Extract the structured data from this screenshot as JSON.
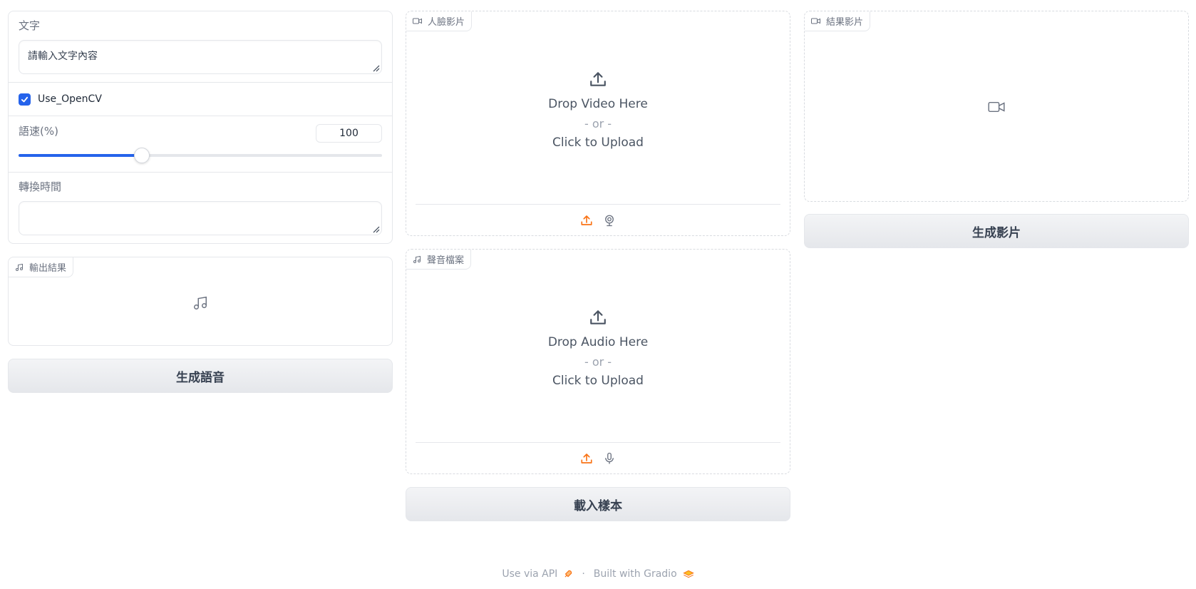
{
  "left": {
    "text_label": "文字",
    "text_placeholder": "請輸入文字內容",
    "checkbox_label": "Use_OpenCV",
    "checkbox_checked": true,
    "speed_label": "語速(%)",
    "speed_value": "100",
    "speed_fraction": 0.34,
    "time_label": "轉換時間",
    "time_value": "",
    "output_label": "輸出結果",
    "generate_button": "生成語音"
  },
  "middle": {
    "video_label": "人臉影片",
    "video_drop": "Drop Video Here",
    "or_text": "- or -",
    "click_upload": "Click to Upload",
    "audio_label": "聲音檔案",
    "audio_drop": "Drop Audio Here",
    "or_text2": "- or -",
    "click_upload2": "Click to Upload",
    "load_button": "載入樣本"
  },
  "right": {
    "result_label": "結果影片",
    "generate_button": "生成影片"
  },
  "footer": {
    "api": "Use via API",
    "dot": "·",
    "built": "Built with Gradio"
  },
  "colors": {
    "accent": "#2563eb",
    "upload_orange": "#f97316"
  }
}
